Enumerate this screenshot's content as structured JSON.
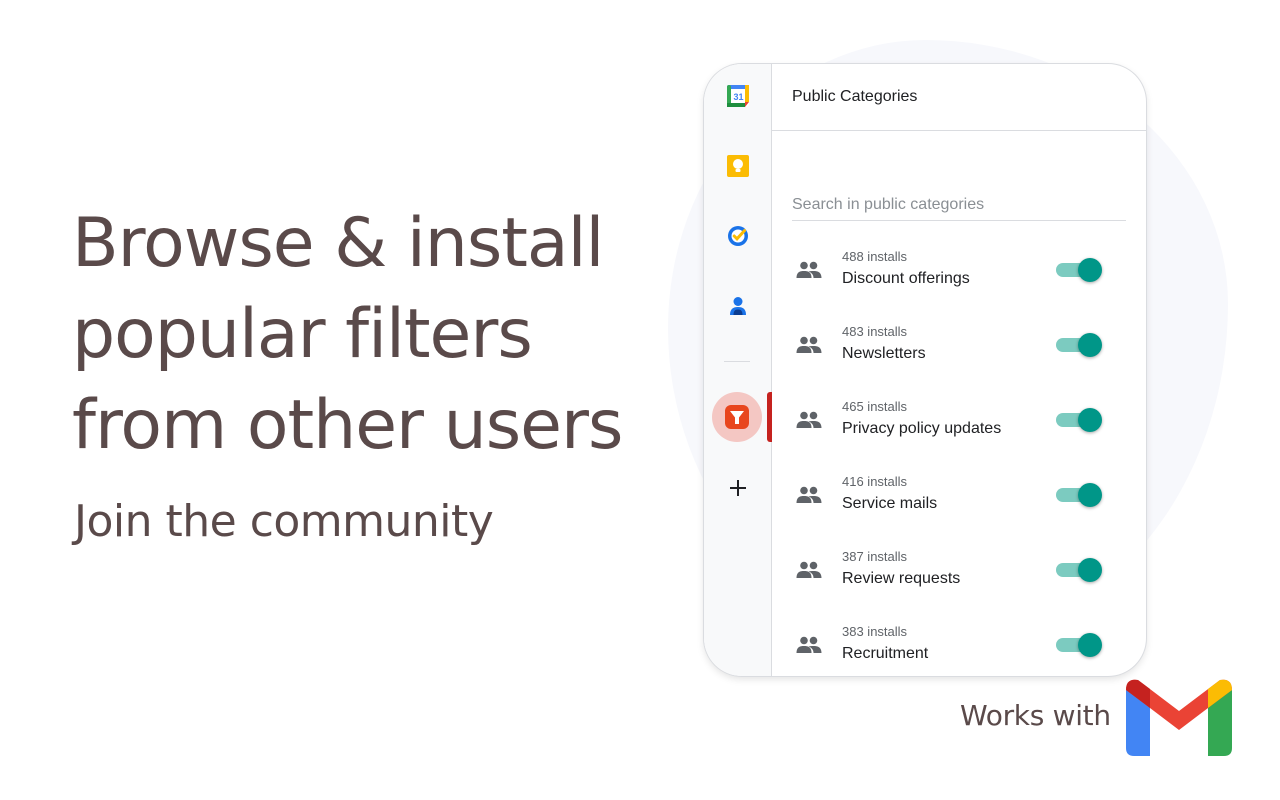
{
  "hero": {
    "headline_lines": [
      "Browse & install",
      "popular filters",
      "from other users"
    ],
    "subheadline": "Join the community"
  },
  "panel": {
    "title": "Public Categories",
    "search": {
      "placeholder": "Search in public categories",
      "value": ""
    },
    "rail_icons": [
      "calendar-icon",
      "keep-icon",
      "tasks-icon",
      "contacts-icon",
      "filter-addon-icon",
      "add-icon"
    ],
    "calendar_day": "31",
    "categories": [
      {
        "installs": "488 installs",
        "name": "Discount offerings",
        "enabled": true
      },
      {
        "installs": "483 installs",
        "name": "Newsletters",
        "enabled": true
      },
      {
        "installs": "465 installs",
        "name": "Privacy policy updates",
        "enabled": true
      },
      {
        "installs": "416 installs",
        "name": "Service mails",
        "enabled": true
      },
      {
        "installs": "387 installs",
        "name": "Review requests",
        "enabled": true
      },
      {
        "installs": "383 installs",
        "name": "Recruitment",
        "enabled": true
      }
    ]
  },
  "footer": {
    "works_with": "Works with",
    "logo_icon": "gmail-logo-icon"
  },
  "colors": {
    "headline": "#5a4a4a",
    "toggle_on": "#009688",
    "toggle_track": "#7ccbc0",
    "active_bubble": "#f4c7c3",
    "active_bar": "#c5221f"
  }
}
